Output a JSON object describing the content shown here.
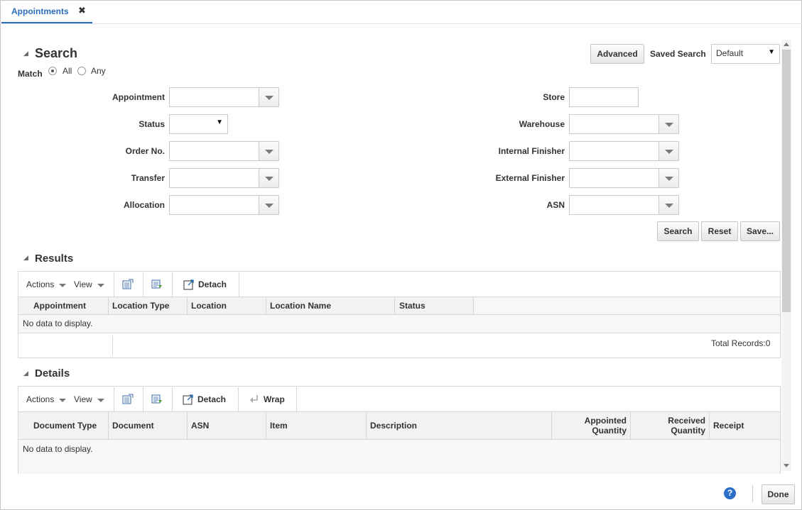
{
  "tab": {
    "label": "Appointments",
    "close": "✖"
  },
  "search": {
    "title": "Search",
    "advanced_label": "Advanced",
    "saved_search_label": "Saved Search",
    "saved_search_value": "Default",
    "match_label": "Match",
    "match_all": "All",
    "match_any": "Any",
    "fields": {
      "appointment": "Appointment",
      "status": "Status",
      "order_no": "Order No.",
      "transfer": "Transfer",
      "allocation": "Allocation",
      "store": "Store",
      "warehouse": "Warehouse",
      "internal_finisher": "Internal Finisher",
      "external_finisher": "External Finisher",
      "asn": "ASN"
    },
    "buttons": {
      "search": "Search",
      "reset": "Reset",
      "save": "Save..."
    }
  },
  "results": {
    "title": "Results",
    "toolbar": {
      "actions": "Actions",
      "view": "View",
      "detach": "Detach"
    },
    "columns": [
      "Appointment",
      "Location Type",
      "Location",
      "Location Name",
      "Status"
    ],
    "empty_text": "No data to display.",
    "total_records": "Total Records:0"
  },
  "details": {
    "title": "Details",
    "toolbar": {
      "actions": "Actions",
      "view": "View",
      "detach": "Detach",
      "wrap": "Wrap"
    },
    "columns": [
      "Document Type",
      "Document",
      "ASN",
      "Item",
      "Description"
    ],
    "appointed_qty": [
      "Appointed",
      "Quantity"
    ],
    "received_qty": [
      "Received",
      "Quantity"
    ],
    "receipt": "Receipt",
    "empty_text": "No data to display."
  },
  "footer": {
    "help": "?",
    "done": "Done"
  }
}
